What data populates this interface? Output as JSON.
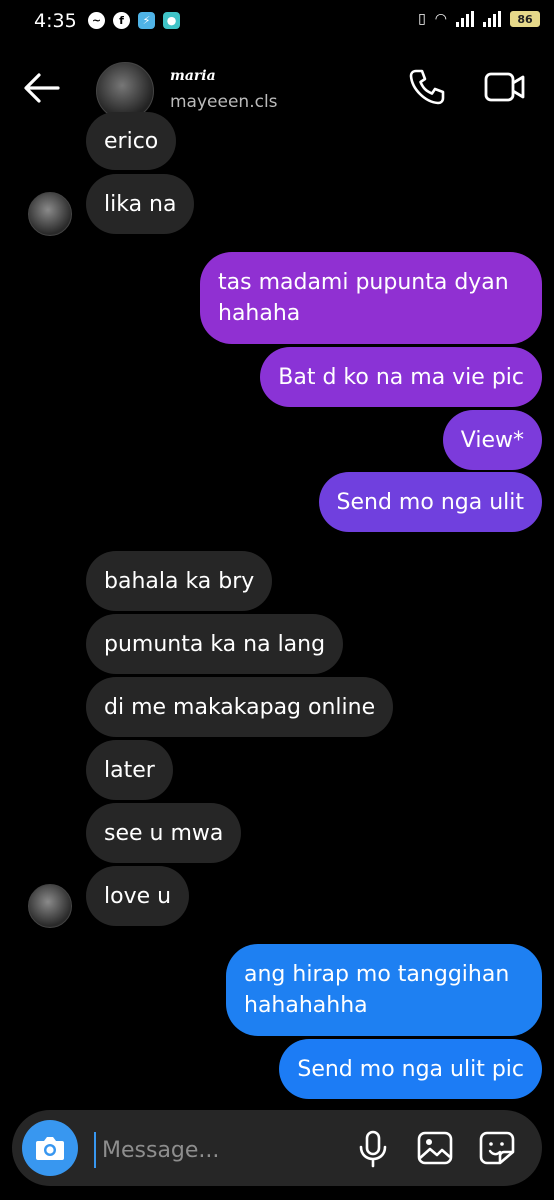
{
  "status_bar": {
    "time": "4:35",
    "battery": "86"
  },
  "header": {
    "name": "maria",
    "handle": "mayeeen.cls"
  },
  "messages": [
    {
      "text": "erico"
    },
    {
      "text": "lika na"
    },
    {
      "text": "tas madami pupunta dyan hahaha"
    },
    {
      "text": "Bat d ko na ma vie pic"
    },
    {
      "text": "View*"
    },
    {
      "text": "Send mo nga ulit"
    },
    {
      "text": "bahala ka bry"
    },
    {
      "text": "pumunta ka na lang"
    },
    {
      "text": "di me makakapag online"
    },
    {
      "text": "later"
    },
    {
      "text": "see u mwa"
    },
    {
      "text": "love u"
    },
    {
      "text": "ang hirap mo tanggihan hahahahha"
    },
    {
      "text": "Send mo nga ulit pic"
    }
  ],
  "composer": {
    "placeholder": "Message..."
  },
  "colors": {
    "incoming": "#262626",
    "purple_top": "#9b2ec9",
    "purple_bottom": "#6f43e2",
    "blue": "#1c7cf5",
    "accent": "#3897f0"
  }
}
